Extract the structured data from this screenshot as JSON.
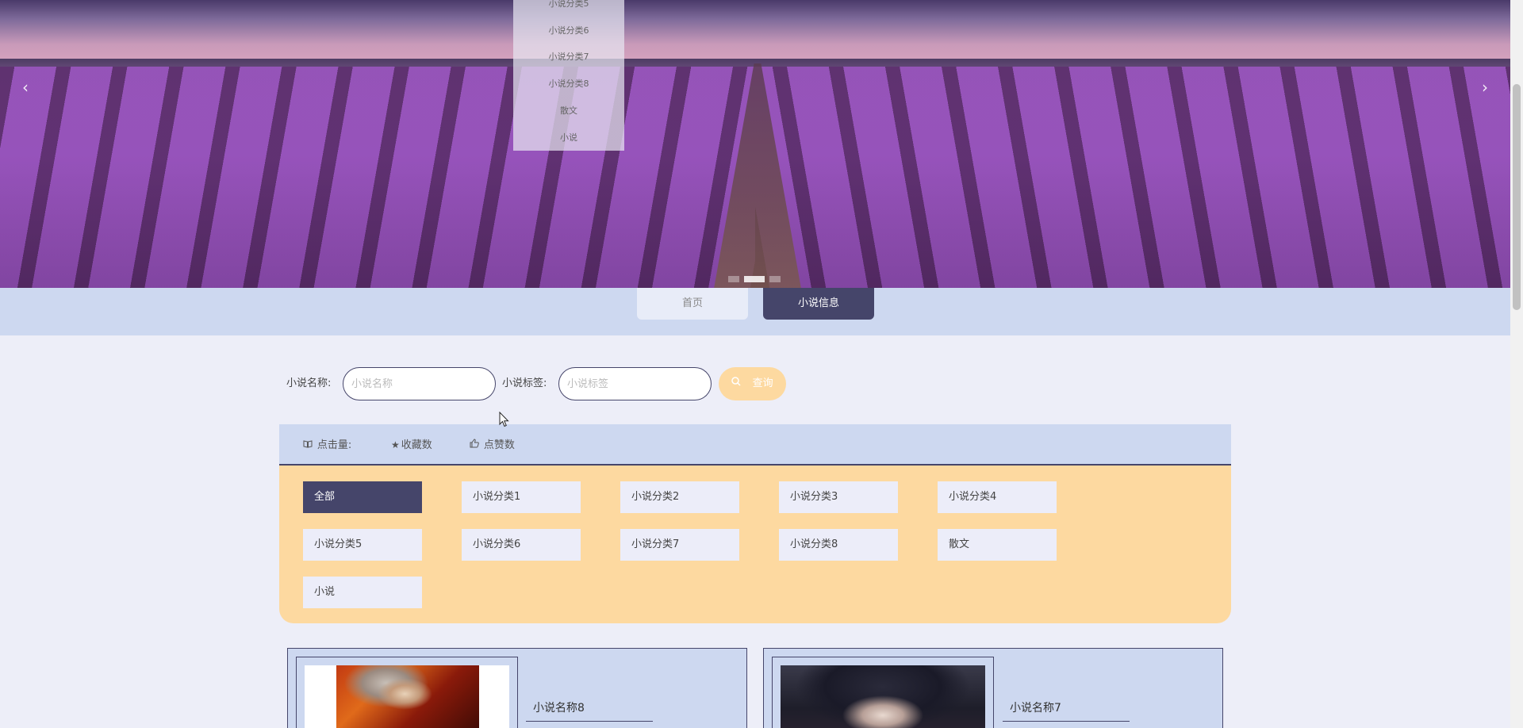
{
  "banner": {
    "prev_icon": "chevron-left-icon",
    "next_icon": "chevron-right-icon",
    "prev_glyph": "‹",
    "next_glyph": "›",
    "slide_count": 3,
    "active_slide": 2
  },
  "dropdown": {
    "items": [
      "小说分类5",
      "小说分类6",
      "小说分类7",
      "小说分类8",
      "散文",
      "小说"
    ]
  },
  "nav": {
    "home": "首页",
    "novel": "小说信息"
  },
  "search": {
    "name_label": "小说名称:",
    "name_placeholder": "小说名称",
    "tag_label": "小说标签:",
    "tag_placeholder": "小说标签",
    "button": "查询",
    "button_icon": "search-icon"
  },
  "sort": {
    "clicks": "点击量:",
    "favorites": "收藏数",
    "likes": "点赞数",
    "clicks_icon": "book-icon",
    "favorites_icon": "star-icon",
    "likes_icon": "thumbs-up-icon"
  },
  "categories": [
    "全部",
    "小说分类1",
    "小说分类2",
    "小说分类3",
    "小说分类4",
    "小说分类5",
    "小说分类6",
    "小说分类7",
    "小说分类8",
    "散文",
    "小说"
  ],
  "active_category": "全部",
  "cards": [
    {
      "title": "小说名称8"
    },
    {
      "title": "小说名称7"
    }
  ],
  "colors": {
    "primary": "#45456a",
    "accent": "#fdd9a0",
    "panel": "#cdd8f0",
    "background": "#edeef8"
  }
}
